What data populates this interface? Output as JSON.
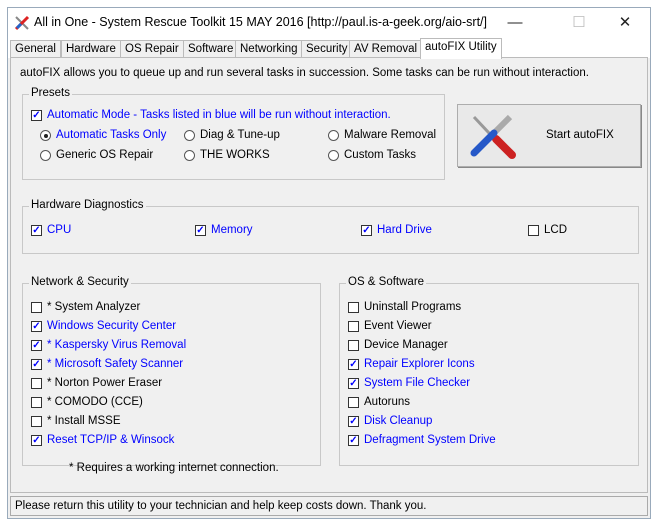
{
  "window": {
    "title": "All in One - System Rescue Toolkit 15 MAY 2016 [http://paul.is-a-geek.org/aio-srt/]",
    "minimize": "—",
    "maximize": "☐",
    "close": "✕"
  },
  "tabs": [
    "General",
    "Hardware",
    "OS Repair",
    "Software",
    "Networking",
    "Security",
    "AV Removal",
    "autoFIX Utility"
  ],
  "intro": "autoFIX allows you to queue up and run several tasks in succession.  Some tasks can be run without interaction.",
  "presets": {
    "label": "Presets",
    "auto_mode": "Automatic Mode - Tasks listed in blue will be run without interaction.",
    "options": [
      {
        "label": "Automatic Tasks Only",
        "selected": true
      },
      {
        "label": "Diag & Tune-up"
      },
      {
        "label": "Malware Removal"
      },
      {
        "label": "Generic OS Repair"
      },
      {
        "label": "THE WORKS"
      },
      {
        "label": "Custom Tasks"
      }
    ]
  },
  "start_button": "Start autoFIX",
  "hardware": {
    "label": "Hardware Diagnostics",
    "items": [
      {
        "label": "CPU",
        "checked": true
      },
      {
        "label": "Memory",
        "checked": true
      },
      {
        "label": "Hard Drive",
        "checked": true
      },
      {
        "label": "LCD",
        "checked": false
      }
    ]
  },
  "network": {
    "label": "Network & Security",
    "items": [
      {
        "label": "* System Analyzer",
        "checked": false,
        "blue": false
      },
      {
        "label": "Windows Security Center",
        "checked": true,
        "blue": true
      },
      {
        "label": "* Kaspersky Virus Removal",
        "checked": true,
        "blue": true
      },
      {
        "label": "* Microsoft Safety Scanner",
        "checked": true,
        "blue": true
      },
      {
        "label": "* Norton Power Eraser",
        "checked": false,
        "blue": false
      },
      {
        "label": "* COMODO (CCE)",
        "checked": false,
        "blue": false
      },
      {
        "label": "* Install MSSE",
        "checked": false,
        "blue": false
      },
      {
        "label": "Reset TCP/IP & Winsock",
        "checked": true,
        "blue": true
      }
    ],
    "footnote": "* Requires a working internet connection."
  },
  "os": {
    "label": "OS & Software",
    "items": [
      {
        "label": "Uninstall Programs",
        "checked": false,
        "blue": false
      },
      {
        "label": "Event Viewer",
        "checked": false,
        "blue": false
      },
      {
        "label": "Device Manager",
        "checked": false,
        "blue": false
      },
      {
        "label": "Repair Explorer Icons",
        "checked": true,
        "blue": true
      },
      {
        "label": "System File Checker",
        "checked": true,
        "blue": true
      },
      {
        "label": "Autoruns",
        "checked": false,
        "blue": false
      },
      {
        "label": "Disk Cleanup",
        "checked": true,
        "blue": true
      },
      {
        "label": "Defragment System Drive",
        "checked": true,
        "blue": true
      }
    ]
  },
  "status": "Please return this utility to your technician and help keep costs down. Thank you."
}
